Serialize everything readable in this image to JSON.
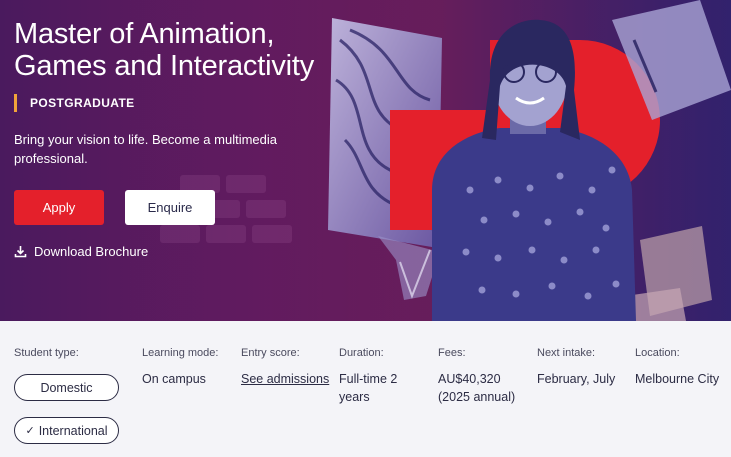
{
  "hero": {
    "title": "Master of Animation, Games and Interactivity",
    "level": "POSTGRADUATE",
    "tagline": "Bring your vision to life. Become a multimedia professional.",
    "apply_label": "Apply",
    "enquire_label": "Enquire",
    "download_label": "Download Brochure"
  },
  "facts": {
    "student_type": {
      "label": "Student type:",
      "options": [
        "Domestic",
        "International"
      ],
      "selected": "International"
    },
    "learning_mode": {
      "label": "Learning mode:",
      "value": "On campus"
    },
    "entry_score": {
      "label": "Entry score:",
      "value": "See admissions"
    },
    "duration": {
      "label": "Duration:",
      "value": "Full-time 2 years"
    },
    "fees": {
      "label": "Fees:",
      "value": "AU$40,320 (2025 annual)"
    },
    "next_intake": {
      "label": "Next intake:",
      "value": "February, July"
    },
    "location": {
      "label": "Location:",
      "value": "Melbourne City"
    }
  },
  "colors": {
    "accent_red": "#e4202b",
    "level_bar": "#f2a33a",
    "hero_purple": "#4a1a5e"
  },
  "icons": {
    "download": "download-icon",
    "check": "check-icon"
  }
}
